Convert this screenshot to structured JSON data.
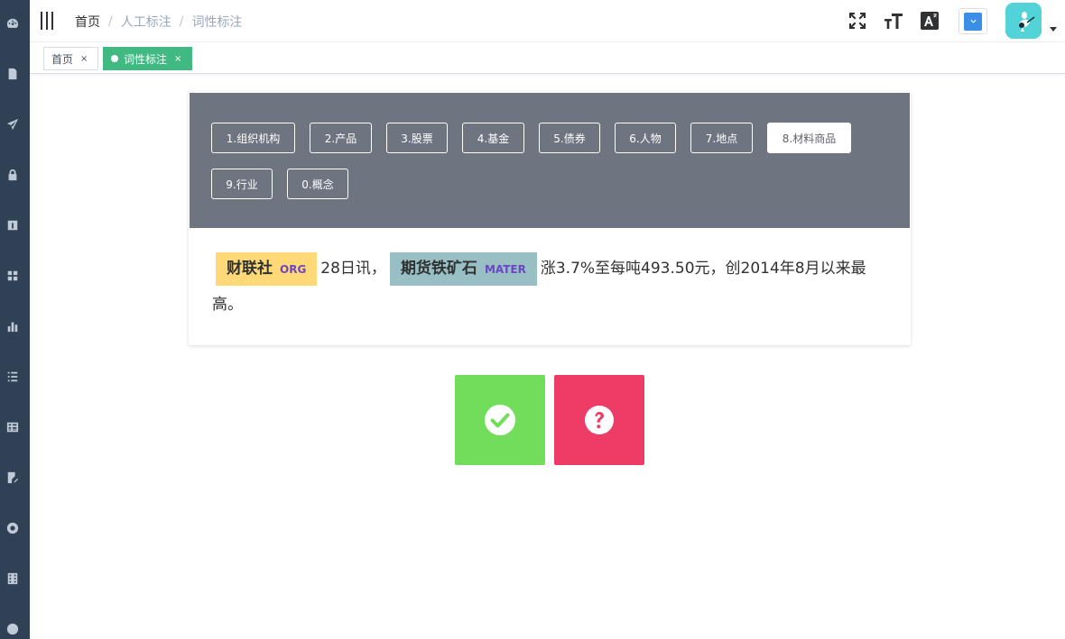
{
  "sidebar": {
    "icons": [
      "dashboard-icon",
      "document-icon",
      "send-icon",
      "lock-icon",
      "info-icon",
      "grid-icon",
      "chart-icon",
      "list-icon",
      "table-icon",
      "edit-icon",
      "help-icon",
      "film-icon",
      "404-icon"
    ]
  },
  "navbar": {
    "breadcrumb": [
      "首页",
      "人工标注",
      "词性标注"
    ],
    "tools": [
      "fullscreen-icon",
      "font-size-icon",
      "translate-icon"
    ],
    "colors": {
      "lang_box": "#3a8ee6",
      "avatar_bg": "#52d3d8"
    }
  },
  "tags_view": {
    "tabs": [
      {
        "label": "首页",
        "close": "×"
      },
      {
        "label": "词性标注",
        "close": "×"
      }
    ],
    "active_color": "#42b983"
  },
  "labels": {
    "buttons": [
      "1.组织机构",
      "2.产品",
      "3.股票",
      "4.基金",
      "5.债券",
      "6.人物",
      "7.地点",
      "8.材料商品",
      "9.行业",
      "0.概念"
    ],
    "selected": "8.材料商品"
  },
  "sentence": {
    "entity1": {
      "text": "财联社",
      "type": "ORG",
      "color": "#ffd977"
    },
    "text1": "28日讯，",
    "entity2": {
      "text": "期货铁矿石",
      "type": "MATER",
      "color": "#98c0c4"
    },
    "text2": "涨3.7%至每吨493.50元，创2014年8月以来最高。"
  },
  "actions": {
    "confirm": {
      "icon": "check-circle-icon",
      "color": "#72dd5a"
    },
    "question": {
      "icon": "question-circle-icon",
      "color": "#ed3d66"
    }
  }
}
